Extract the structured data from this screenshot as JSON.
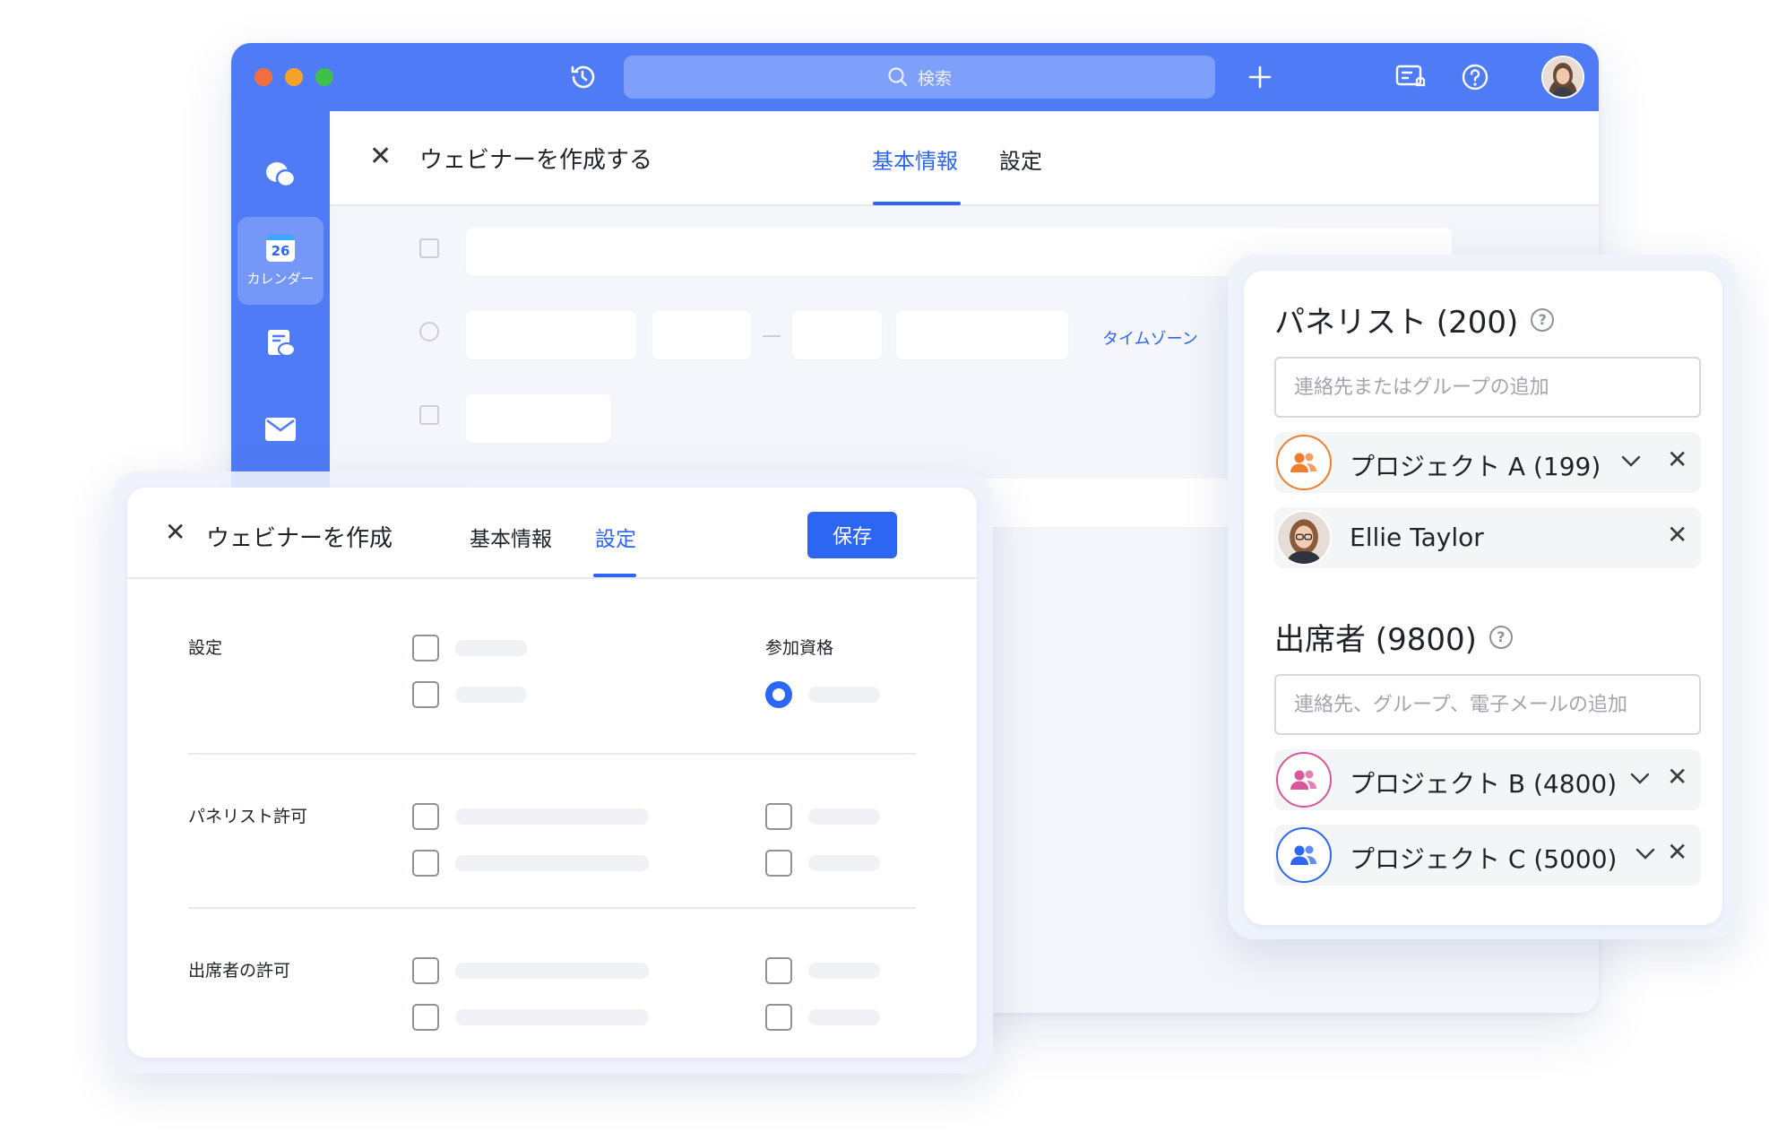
{
  "colors": {
    "accent": "#2d66f3",
    "titlebar": "#4f7cf6",
    "project_a": "#f07d2b",
    "project_b": "#d9569b",
    "project_c": "#2d66f3"
  },
  "window": {
    "search_placeholder": "検索",
    "sidebar": {
      "calendar_day": "26",
      "calendar_label": "カレンダー"
    },
    "title": "ウェビナーを作成する",
    "tabs": [
      "基本情報",
      "設定"
    ],
    "timezone_link": "タイムゾーン"
  },
  "settings_card": {
    "title": "ウェビナーを作成",
    "tabs": [
      "基本情報",
      "設定"
    ],
    "save_label": "保存",
    "sections": {
      "settings": "設定",
      "eligibility": "参加資格",
      "panelist_permissions": "パネリスト許可",
      "attendee_permissions": "出席者の許可"
    }
  },
  "panelists_card": {
    "panelists_heading": "パネリスト (200)",
    "panelists_placeholder": "連絡先またはグループの追加",
    "panelists": [
      {
        "name": "プロジェクト A (199)",
        "icon": "group-icon",
        "color": "#f07d2b",
        "expandable": true
      },
      {
        "name": "Ellie Taylor",
        "icon": "user-avatar",
        "expandable": false
      }
    ],
    "attendees_heading": "出席者 (9800)",
    "attendees_placeholder": "連絡先、グループ、電子メールの追加",
    "attendees": [
      {
        "name": "プロジェクト B (4800)",
        "icon": "group-icon",
        "color": "#d9569b",
        "expandable": true
      },
      {
        "name": "プロジェクト C (5000)",
        "icon": "group-icon",
        "color": "#2d66f3",
        "expandable": true
      }
    ],
    "help_glyph": "?"
  }
}
